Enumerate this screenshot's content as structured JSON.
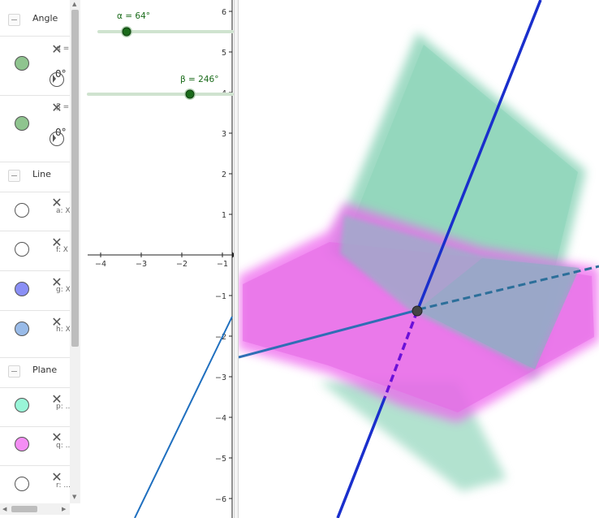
{
  "algebra": {
    "groups": [
      {
        "label": "Angle"
      },
      {
        "label": "Line"
      },
      {
        "label": "Plane"
      }
    ],
    "angle_rows": [
      {
        "color": "#8fc48f",
        "def": "α =",
        "value": "0°"
      },
      {
        "color": "#8fc48f",
        "def": "β =",
        "value": "0°"
      }
    ],
    "line_rows": [
      {
        "color": "#ffffff",
        "def": "a: X"
      },
      {
        "color": "#ffffff",
        "def": "f: X"
      },
      {
        "color": "#8a8ff5",
        "def": "g: X"
      },
      {
        "color": "#99bbe8",
        "def": "h: X"
      }
    ],
    "plane_rows": [
      {
        "color": "#99f5d8",
        "def": "p: ..."
      },
      {
        "color": "#f48ef4",
        "def": "q: ..."
      },
      {
        "color": "#ffffff",
        "def": "r: ..."
      }
    ]
  },
  "graphics2d": {
    "slider_alpha": {
      "label": "α = 64°",
      "value_deg": 64,
      "min_deg": 0,
      "max_deg": 360
    },
    "slider_beta": {
      "label": "β = 246°",
      "value_deg": 246,
      "min_deg": 0,
      "max_deg": 360
    },
    "y_ticks": [
      "6",
      "5",
      "4",
      "3",
      "2",
      "1",
      "−1",
      "−2",
      "−3",
      "−4",
      "−5",
      "−6"
    ],
    "x_ticks": [
      "−4",
      "−3",
      "−2",
      "−1"
    ],
    "colors": {
      "slider_track": "#cfe3cf",
      "slider_knob": "#1a6b1a",
      "label": "#1a6b1a",
      "line": "#1f6fbf"
    }
  },
  "graphics3d": {
    "colors": {
      "plane_p": "#7fcfb0",
      "plane_q": "#ee66ee",
      "line_blue": "#1a2fcc",
      "line_steel": "#2f6eb5",
      "dashed_purple": "#6a10d8",
      "dashed_teal": "#2c6f9a",
      "point": "#444444"
    }
  }
}
